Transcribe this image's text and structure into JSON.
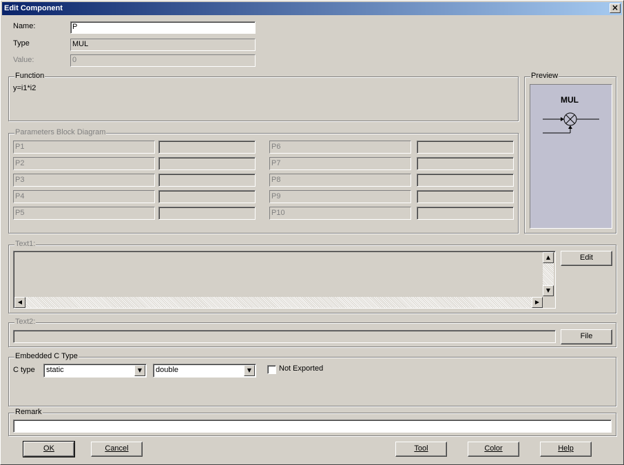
{
  "window": {
    "title": "Edit Component",
    "close_symbol": "×"
  },
  "form": {
    "name_label": "Name:",
    "name_value": "P",
    "type_label": "Type",
    "type_value": "MUL",
    "value_label": "Value:",
    "value_value": "0"
  },
  "function_group": {
    "title": "Function",
    "text": "y=i1*i2"
  },
  "preview_group": {
    "title": "Preview",
    "block_label": "MUL"
  },
  "parameters_group": {
    "title": "Parameters Block Diagram",
    "left": [
      "P1",
      "P2",
      "P3",
      "P4",
      "P5"
    ],
    "right": [
      "P6",
      "P7",
      "P8",
      "P9",
      "P10"
    ]
  },
  "text1_group": {
    "title": "Text1:",
    "edit_button": "Edit"
  },
  "text2_group": {
    "title": "Text2:",
    "file_button": "File"
  },
  "embedded_group": {
    "title": "Embedded C Type",
    "ctype_label": "C type",
    "storage_value": "static",
    "datatype_value": "double",
    "not_exported_label": "Not Exported",
    "not_exported_checked": false
  },
  "remark_group": {
    "title": "Remark",
    "value": ""
  },
  "buttons": {
    "ok": "OK",
    "cancel": "Cancel",
    "tool": "Tool",
    "color": "Color",
    "help": "Help"
  },
  "icons": {
    "close": "close-icon",
    "multiply_symbol": "multiply-icon",
    "scroll_up": "scroll-up-icon",
    "scroll_down": "scroll-down-icon",
    "scroll_left": "scroll-left-icon",
    "scroll_right": "scroll-right-icon",
    "dropdown": "chevron-down-icon"
  },
  "colors": {
    "title_start": "#0a246a",
    "title_end": "#a6caf0",
    "face": "#d4d0c8",
    "preview_bg": "#c0c0d0"
  }
}
